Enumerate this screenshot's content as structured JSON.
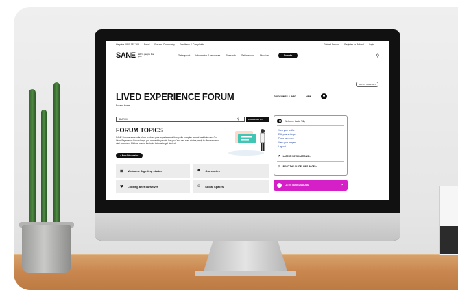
{
  "site": {
    "utility_links": [
      "Helpline 1800 187 263",
      "Email",
      "Forums Community",
      "Feedback & Complaints"
    ],
    "utility_right": [
      "Guided Service",
      "Register or Refund",
      "Login"
    ],
    "logo": "SANE",
    "logo_tagline": "We're people like you",
    "nav": [
      "Get support",
      "Information & resources",
      "Research",
      "Get involved",
      "About us"
    ],
    "donate": "Donate",
    "crisis_button": "CRISIS SUPPORT"
  },
  "page": {
    "title": "LIVED EXPERIENCE FORUM",
    "breadcrumb": "Forums Home",
    "header_links": [
      "GUIDELINES & INFO",
      "NEW"
    ],
    "search_placeholder": "SEARCH",
    "community_dropdown": "COMMUNITY",
    "topics_title": "FORUM TOPICS",
    "topics_intro": "SANE Forums are a safe place to share your experience of living with complex mental health issues. Our Lived Experience Forum helps you connect to people like you. You can read stories, reply to discussions or start your own. Click on one of the topic buttons to get started.",
    "new_discussion": "New Discussion",
    "topics": [
      "Welcome & getting started",
      "Our stories",
      "Looking after ourselves",
      "Social Spaces"
    ]
  },
  "sidebar": {
    "welcome": "Welcome back, Tilly",
    "links": [
      "View your profile",
      "Edit your settings",
      "Posts for review",
      "View your images",
      "Log out"
    ],
    "notifications": "LATEST NOTIFICATIONS >",
    "guidelines": "READ THE GUIDELINES PAGE >",
    "latest_discussions": "LATEST DISCUSSIONS"
  }
}
